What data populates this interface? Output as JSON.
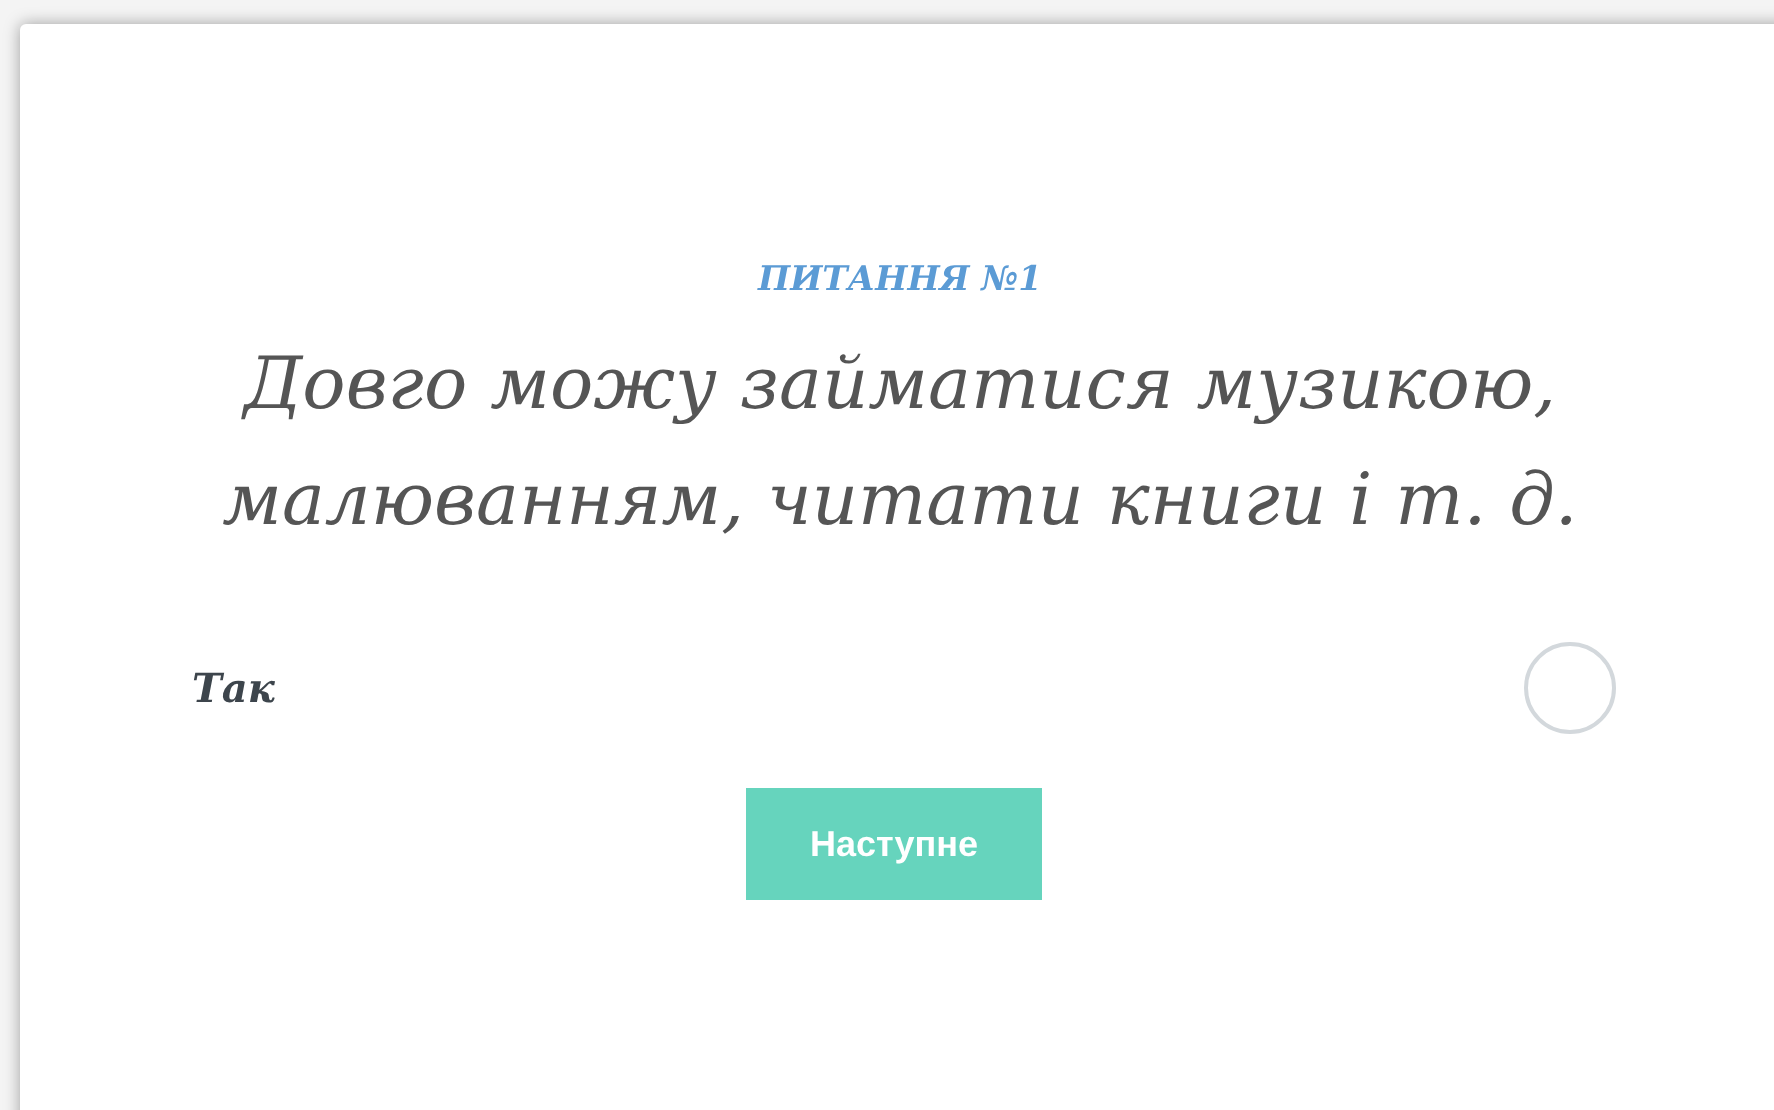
{
  "question": {
    "label": "ПИТАННЯ №1",
    "text": "Довго можу займатися музикою, малюванням, читати книги і т. д."
  },
  "options": [
    {
      "label": "Так",
      "selected": false
    }
  ],
  "button": {
    "label": "Наступне"
  }
}
